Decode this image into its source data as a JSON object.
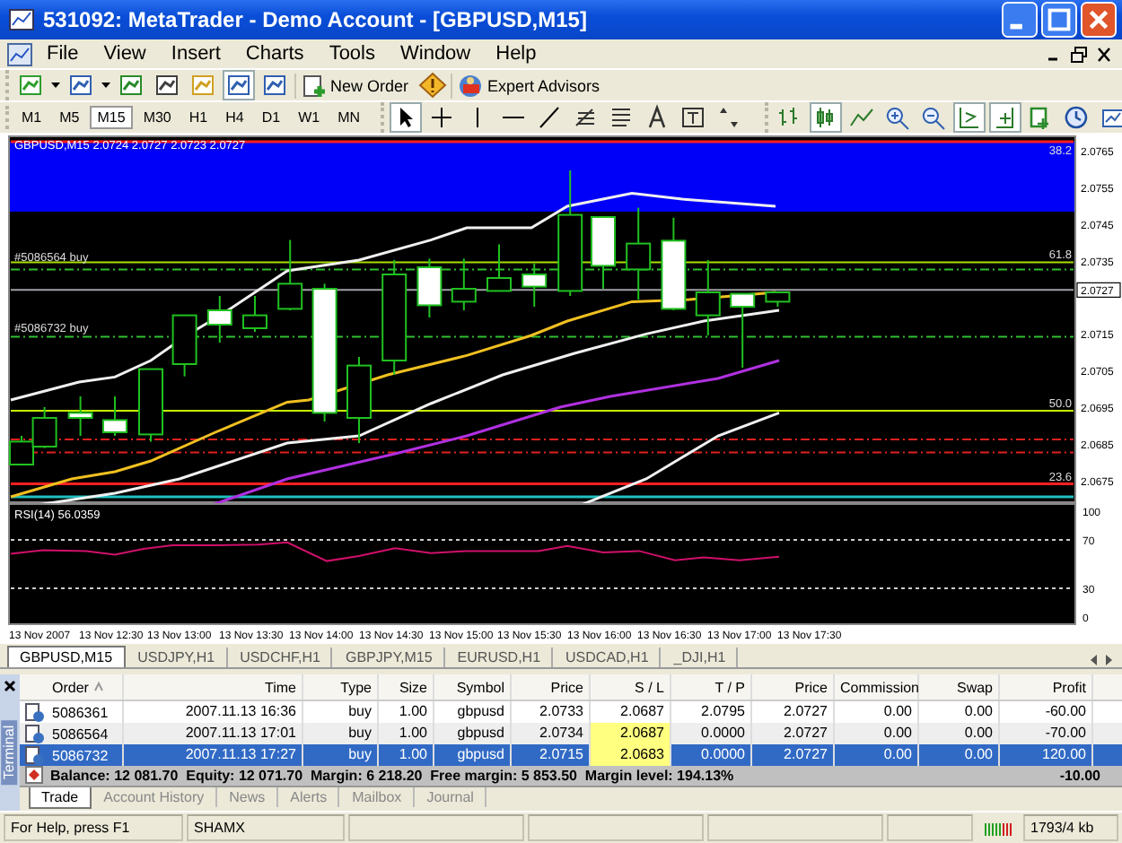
{
  "window": {
    "title": "531092: MetaTrader - Demo Account - [GBPUSD,M15]"
  },
  "menu": [
    "File",
    "View",
    "Insert",
    "Charts",
    "Tools",
    "Window",
    "Help"
  ],
  "toolbar": {
    "buttons": [
      "New Order",
      "Expert Advisors"
    ],
    "timeframes": [
      {
        "label": "M1",
        "selected": false
      },
      {
        "label": "M5",
        "selected": false
      },
      {
        "label": "M15",
        "selected": true
      },
      {
        "label": "M30",
        "selected": false
      },
      {
        "label": "H1",
        "selected": false
      },
      {
        "label": "H4",
        "selected": false
      },
      {
        "label": "D1",
        "selected": false
      },
      {
        "label": "W1",
        "selected": false
      },
      {
        "label": "MN",
        "selected": false
      }
    ]
  },
  "chart": {
    "info": "GBPUSD,M15  2.0724 2.0727 2.0723 2.0727",
    "order_labels": [
      "#5086564 buy",
      "#5086732 buy"
    ],
    "level_labels": [
      "38.2",
      "61.8",
      "50.0",
      "23.6"
    ],
    "price_scale": [
      "2.0765",
      "2.0755",
      "2.0745",
      "2.0735",
      "2.0715",
      "2.0705",
      "2.0695",
      "2.0685",
      "2.0675"
    ],
    "current_price": "2.0727",
    "rsi": {
      "label": "RSI(14) 56.0359",
      "scale": [
        "100",
        "70",
        "30",
        "0"
      ]
    },
    "time_axis": [
      "13 Nov 2007",
      "13 Nov 12:30",
      "13 Nov 13:00",
      "13 Nov 13:30",
      "13 Nov 14:00",
      "13 Nov 14:30",
      "13 Nov 15:00",
      "13 Nov 15:30",
      "13 Nov 16:00",
      "13 Nov 16:30",
      "13 Nov 17:00",
      "13 Nov 17:30"
    ]
  },
  "chart_tabs": [
    {
      "label": "GBPUSD,M15",
      "selected": true
    },
    {
      "label": "USDJPY,H1",
      "selected": false
    },
    {
      "label": "USDCHF,H1",
      "selected": false
    },
    {
      "label": "GBPJPY,M15",
      "selected": false
    },
    {
      "label": "EURUSD,H1",
      "selected": false
    },
    {
      "label": "USDCAD,H1",
      "selected": false
    },
    {
      "label": "_DJI,H1",
      "selected": false
    }
  ],
  "terminal": {
    "title": "Terminal",
    "columns": [
      "Order",
      "Time",
      "Type",
      "Size",
      "Symbol",
      "Price",
      "S / L",
      "T / P",
      "Price",
      "Commission",
      "Swap",
      "Profit"
    ],
    "orders": [
      {
        "order": "5086361",
        "time": "2007.11.13 16:36",
        "type": "buy",
        "size": "1.00",
        "symbol": "gbpusd",
        "price": "2.0733",
        "sl": "2.0687",
        "tp": "2.0795",
        "current_price": "2.0727",
        "commission": "0.00",
        "swap": "0.00",
        "profit": "-60.00",
        "sl_highlighted": false,
        "selected": false
      },
      {
        "order": "5086564",
        "time": "2007.11.13 17:01",
        "type": "buy",
        "size": "1.00",
        "symbol": "gbpusd",
        "price": "2.0734",
        "sl": "2.0687",
        "tp": "0.0000",
        "current_price": "2.0727",
        "commission": "0.00",
        "swap": "0.00",
        "profit": "-70.00",
        "sl_highlighted": true,
        "selected": false
      },
      {
        "order": "5086732",
        "time": "2007.11.13 17:27",
        "type": "buy",
        "size": "1.00",
        "symbol": "gbpusd",
        "price": "2.0715",
        "sl": "2.0683",
        "tp": "0.0000",
        "current_price": "2.0727",
        "commission": "0.00",
        "swap": "0.00",
        "profit": "120.00",
        "sl_highlighted": true,
        "selected": true
      }
    ],
    "balance": "Balance: 12 081.70  Equity: 12 071.70  Margin: 6 218.20  Free margin: 5 853.50  Margin level: 194.13%",
    "balance_profit": "-10.00",
    "tabs": [
      {
        "label": "Trade",
        "selected": true
      },
      {
        "label": "Account History",
        "selected": false
      },
      {
        "label": "News",
        "selected": false
      },
      {
        "label": "Alerts",
        "selected": false
      },
      {
        "label": "Mailbox",
        "selected": false
      },
      {
        "label": "Journal",
        "selected": false
      }
    ]
  },
  "status_bar": {
    "help": "For Help, press F1",
    "profile": "SHAMX",
    "traffic": "1793/4 kb"
  }
}
